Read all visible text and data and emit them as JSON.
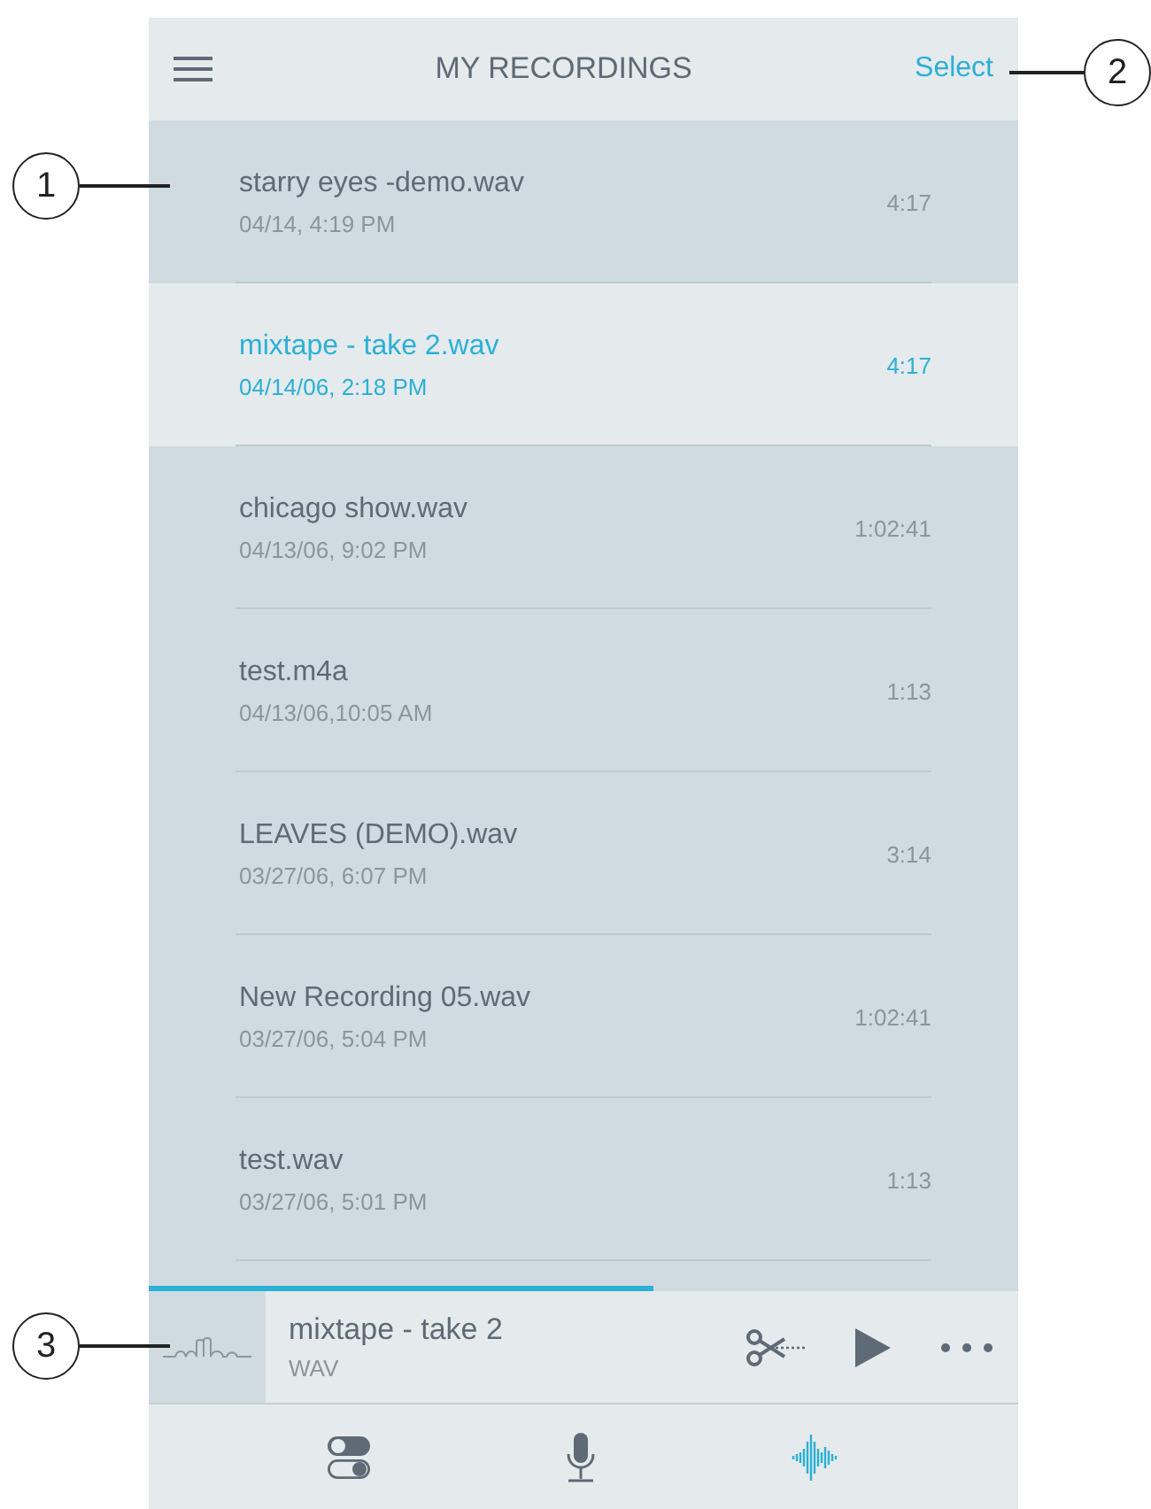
{
  "header": {
    "title": "MY RECORDINGS",
    "action": "Select"
  },
  "recordings": [
    {
      "name": "starry eyes -demo.wav",
      "date": "04/14, 4:19 PM",
      "duration": "4:17",
      "selected": false
    },
    {
      "name": "mixtape - take 2.wav",
      "date": "04/14/06, 2:18 PM",
      "duration": "4:17",
      "selected": true
    },
    {
      "name": "chicago show.wav",
      "date": "04/13/06, 9:02 PM",
      "duration": "1:02:41",
      "selected": false
    },
    {
      "name": "test.m4a",
      "date": "04/13/06,10:05 AM",
      "duration": "1:13",
      "selected": false
    },
    {
      "name": "LEAVES (DEMO).wav",
      "date": "03/27/06, 6:07 PM",
      "duration": "3:14",
      "selected": false
    },
    {
      "name": "New Recording 05.wav",
      "date": "03/27/06, 5:04 PM",
      "duration": "1:02:41",
      "selected": false
    },
    {
      "name": "test.wav",
      "date": "03/27/06, 5:01 PM",
      "duration": "1:13",
      "selected": false
    }
  ],
  "player": {
    "title": "mixtape - take 2",
    "format": "WAV",
    "level": 0.58
  },
  "nav": [
    {
      "kind": "toggles",
      "selected": false
    },
    {
      "kind": "mic",
      "selected": false
    },
    {
      "kind": "wave",
      "selected": true
    }
  ],
  "callouts": [
    {
      "label": "1"
    },
    {
      "label": "2"
    },
    {
      "label": "3"
    }
  ]
}
